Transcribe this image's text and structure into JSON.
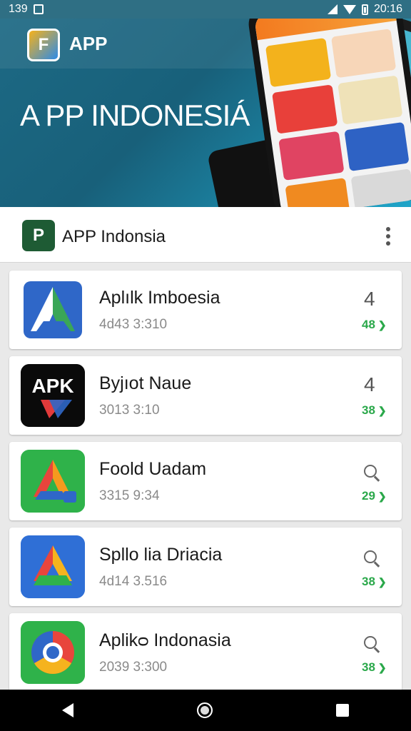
{
  "status_bar": {
    "time_left": "139",
    "time_right": "20:16"
  },
  "hero": {
    "brand": "APP",
    "title": "A PP INDONESIÁ"
  },
  "toolbar": {
    "logo_letter": "P",
    "title": "APP Indonsia",
    "menu_icon": "more-vert-icon"
  },
  "apps": [
    {
      "name": "Aplılk Imboesia",
      "meta": "4d43 3:310",
      "rank": "4",
      "score": "48",
      "icon": "drive-blue-icon"
    },
    {
      "name": "Byjıot Naue",
      "meta": "3013 3:10",
      "rank": "4",
      "score": "38",
      "icon": "apk-icon"
    },
    {
      "name": "Foold Uadam",
      "meta": "3315 9:34",
      "rank": "search",
      "score": "29",
      "icon": "drive-green-icon"
    },
    {
      "name": "Spllo lia Driacia",
      "meta": "4d14 3.516",
      "rank": "search",
      "score": "38",
      "icon": "drive-tri-icon"
    },
    {
      "name": "Aplikᴑ Indonasia",
      "meta": "2039 3:300",
      "rank": "search",
      "score": "38",
      "icon": "chrome-icon"
    }
  ],
  "apk_label": "APK",
  "colors": {
    "accent_green": "#2aa84a",
    "hero_blue": "#1d6a85",
    "toolbar_bg": "#ffffff"
  }
}
